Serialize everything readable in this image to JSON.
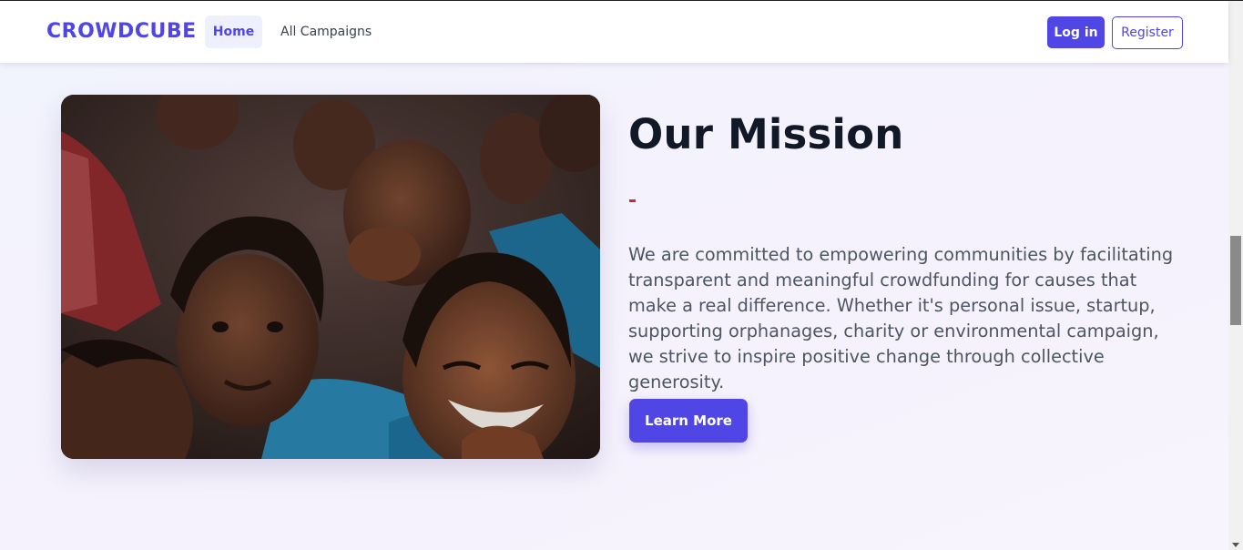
{
  "navbar": {
    "brand": "CROWDCUBE",
    "links": [
      {
        "label": "Home",
        "active": true
      },
      {
        "label": "All Campaigns",
        "active": false
      }
    ],
    "login_label": "Log in",
    "register_label": "Register"
  },
  "mission": {
    "title": "Our Mission",
    "accent_mark": "-",
    "description": "We are committed to empowering communities by facilitating transparent and meaningful crowdfunding for causes that make a real difference. Whether it's personal issue, startup, supporting orphanages, charity or environmental campaign, we strive to inspire positive change through collective generosity.",
    "cta_label": "Learn More"
  },
  "colors": {
    "accent": "#4f46e5",
    "heading": "#111827",
    "body_text": "#4b5563",
    "dash": "#dc2626"
  }
}
